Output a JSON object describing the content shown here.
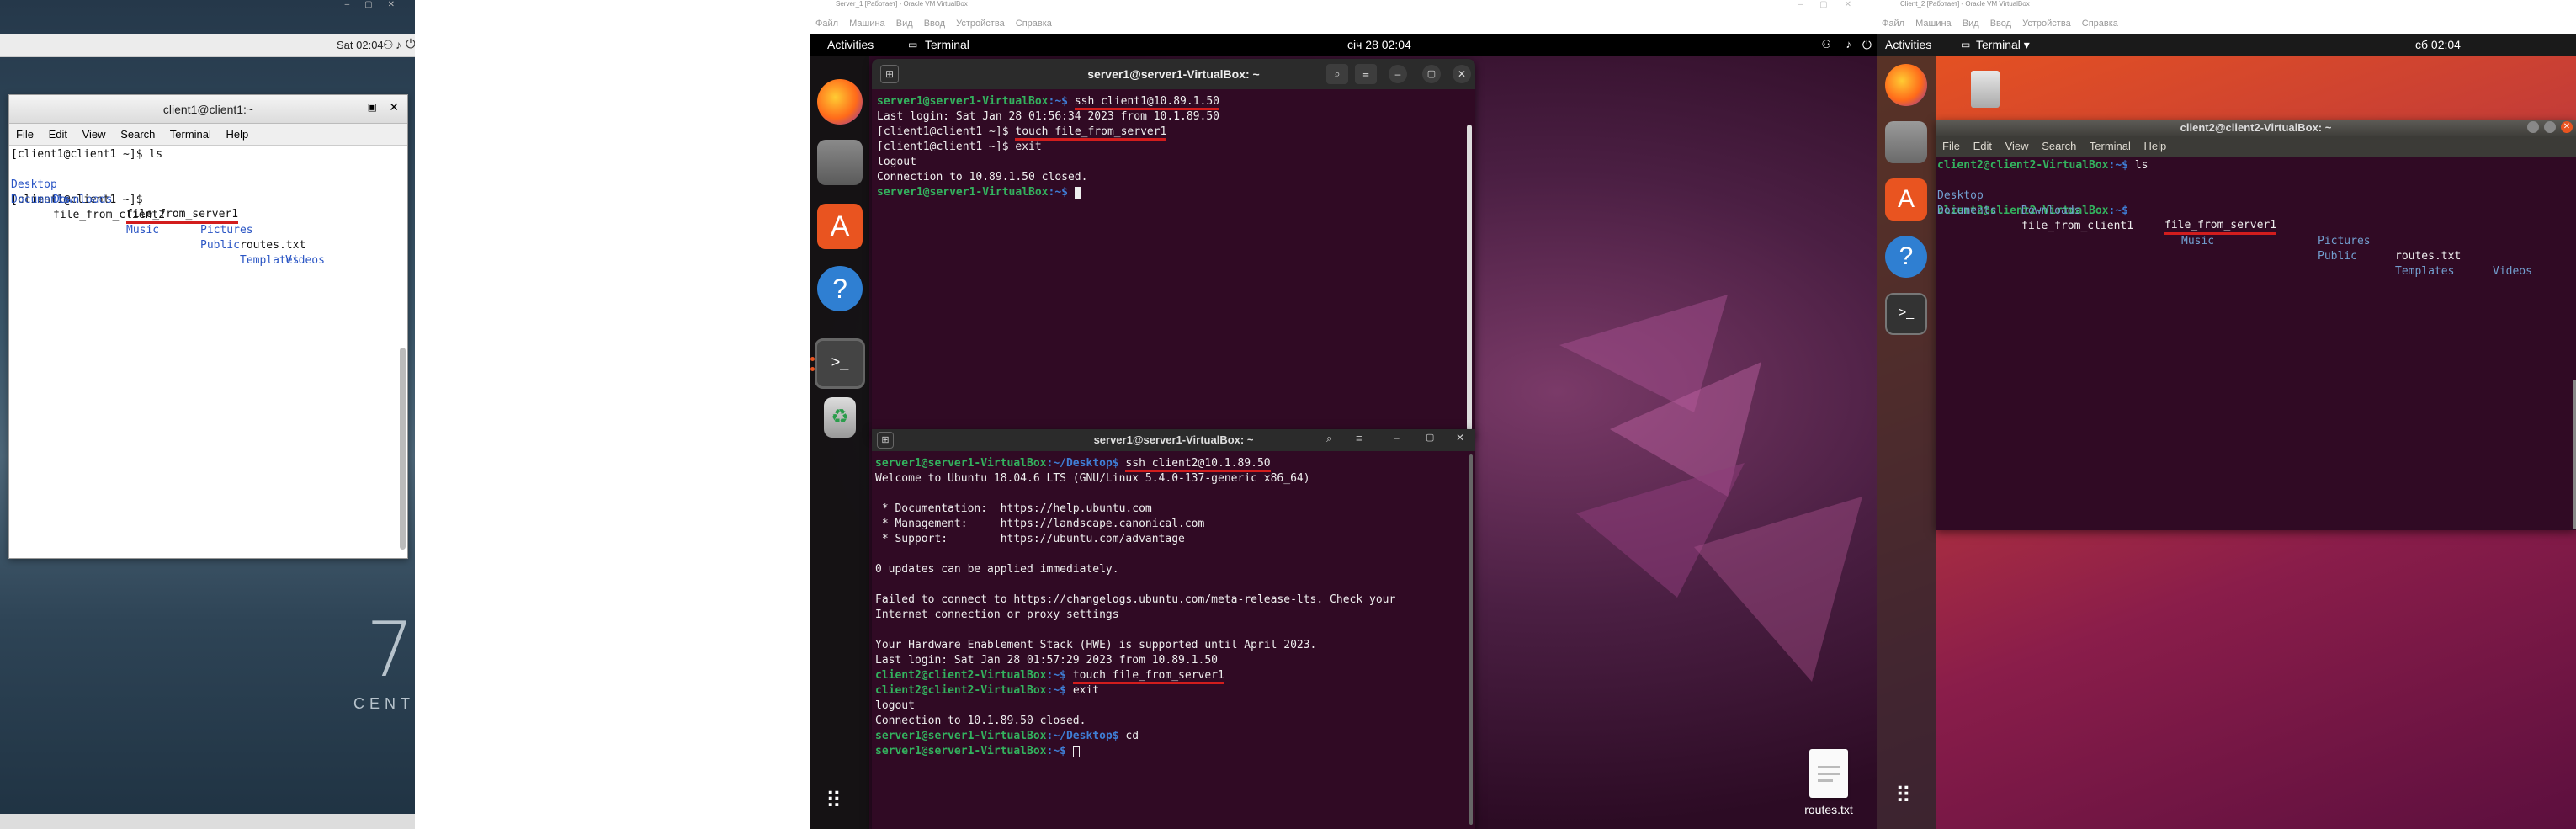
{
  "vm1": {
    "topbar_clock": "Sat 02:04",
    "window_title": "client1@client1:~",
    "menu": [
      "File",
      "Edit",
      "View",
      "Search",
      "Terminal",
      "Help"
    ],
    "lines": [
      {
        "prompt": "[client1@client1 ~]$ ",
        "cmd": "ls"
      }
    ],
    "ls_row1": {
      "c1": "Desktop",
      "c2": "Downloads",
      "c3": "file_from_server1",
      "c4": "Pictures",
      "c5": "routes.txt",
      "c6": "Videos"
    },
    "ls_row2": {
      "c1": "Documents",
      "c2": "file_from_client2",
      "c3": "Music",
      "c4": "Public",
      "c5": "Templates"
    },
    "last_prompt": "[client1@client1 ~]$ ",
    "centos_number": "7",
    "centos_text": "CENTOS"
  },
  "vm2": {
    "title": "Server_1 [Работает] - Oracle VM VirtualBox",
    "vbox_menu": [
      "Файл",
      "Машина",
      "Вид",
      "Ввод",
      "Устройства",
      "Справка"
    ],
    "activities": "Activities",
    "app_name": "Terminal",
    "clock": "січ 28  02:04",
    "term1": {
      "title": "server1@server1-VirtualBox: ~",
      "l1_prompt": "server1@server1-VirtualBox",
      "l1_path": ":~$ ",
      "l1_cmd": "ssh client1@10.89.1.50",
      "l2": "Last login: Sat Jan 28 01:56:34 2023 from 10.1.89.50",
      "l3_prompt": "[client1@client1 ~]$ ",
      "l3_cmd": "touch file_from_server1",
      "l4": "[client1@client1 ~]$ exit",
      "l5": "logout",
      "l6": "Connection to 10.89.1.50 closed.",
      "l7_prompt": "server1@server1-VirtualBox",
      "l7_path": ":~$ "
    },
    "term2": {
      "title": "server1@server1-VirtualBox: ~",
      "l1_prompt": "server1@server1-VirtualBox",
      "l1_path": ":~/Desktop$ ",
      "l1_cmd": "ssh client2@10.1.89.50",
      "l2": "Welcome to Ubuntu 18.04.6 LTS (GNU/Linux 5.4.0-137-generic x86_64)",
      "l3": " * Documentation:  https://help.ubuntu.com",
      "l4": " * Management:     https://landscape.canonical.com",
      "l5": " * Support:        https://ubuntu.com/advantage",
      "l6": "0 updates can be applied immediately.",
      "l7": "Failed to connect to https://changelogs.ubuntu.com/meta-release-lts. Check your",
      "l8": "Internet connection or proxy settings",
      "l9": "Your Hardware Enablement Stack (HWE) is supported until April 2023.",
      "l10": "Last login: Sat Jan 28 01:57:29 2023 from 10.89.1.50",
      "l11_prompt": "client2@client2-VirtualBox",
      "l11_path": ":~$ ",
      "l11_cmd": "touch file_from_server1",
      "l12_prompt": "client2@client2-VirtualBox",
      "l12_path": ":~$ ",
      "l12_cmd": "exit",
      "l13": "logout",
      "l14": "Connection to 10.1.89.50 closed.",
      "l15_prompt": "server1@server1-VirtualBox",
      "l15_path": ":~/Desktop$ ",
      "l15_cmd": "cd",
      "l16_prompt": "server1@server1-VirtualBox",
      "l16_path": ":~$ "
    },
    "desktop_file": "routes.txt"
  },
  "vm3": {
    "title": "Client_2 [Работает] - Oracle VM VirtualBox",
    "vbox_menu": [
      "Файл",
      "Машина",
      "Вид",
      "Ввод",
      "Устройства",
      "Справка"
    ],
    "activities": "Activities",
    "app_name": "Terminal ▾",
    "clock": "сб 02:04",
    "window_title": "client2@client2-VirtualBox: ~",
    "menu": [
      "File",
      "Edit",
      "View",
      "Search",
      "Terminal",
      "Help"
    ],
    "l1_prompt": "client2@client2-VirtualBox",
    "l1_path": ":~$ ",
    "l1_cmd": "ls",
    "ls_row1": {
      "c1": "Desktop",
      "c2": "Downloads",
      "c3": "file_from_server1",
      "c4": "Pictures",
      "c5": "routes.txt",
      "c6": "Videos"
    },
    "ls_row2": {
      "c1": "Documents",
      "c2": "file_from_client1",
      "c3": "Music",
      "c4": "Public",
      "c5": "Templates"
    },
    "l3_prompt": "client2@client2-VirtualBox",
    "l3_path": ":~$ "
  },
  "colors": {
    "ubuntu_term_bg": "#300a24",
    "prompt_green": "#33b25e",
    "path_blue": "#3f7ed6",
    "underline_red": "#d21d1d"
  }
}
